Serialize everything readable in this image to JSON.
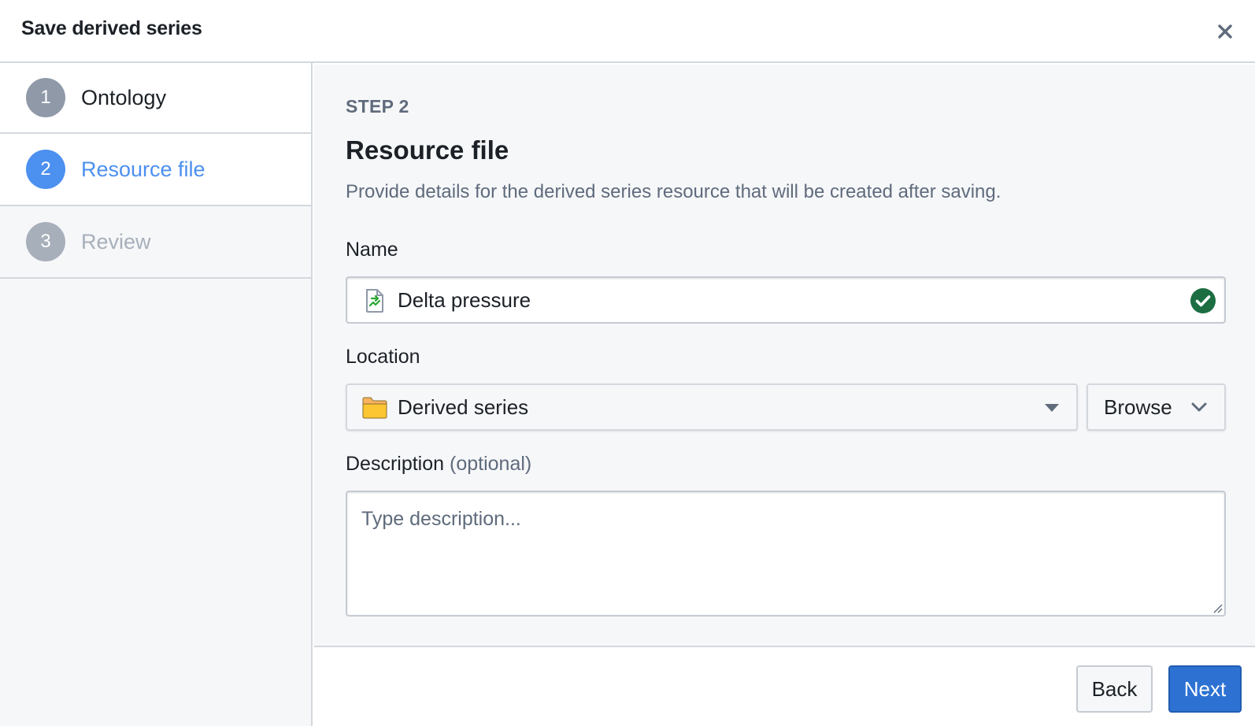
{
  "dialog": {
    "title": "Save derived series",
    "close_icon": "close-icon"
  },
  "steps": [
    {
      "number": "1",
      "label": "Ontology",
      "state": "completed"
    },
    {
      "number": "2",
      "label": "Resource file",
      "state": "active"
    },
    {
      "number": "3",
      "label": "Review",
      "state": "upcoming"
    }
  ],
  "main": {
    "kicker": "STEP 2",
    "title": "Resource file",
    "description": "Provide details for the derived series resource that will be created after saving.",
    "name": {
      "label": "Name",
      "value": "Delta pressure",
      "icon": "derived-series-file-icon",
      "status_icon": "valid-check-icon"
    },
    "location": {
      "label": "Location",
      "value": "Derived series",
      "icon": "folder-icon",
      "browse_label": "Browse"
    },
    "description_field": {
      "label": "Description",
      "optional_hint": "(optional)",
      "placeholder": "Type description...",
      "value": ""
    }
  },
  "footer": {
    "back_label": "Back",
    "next_label": "Next"
  },
  "colors": {
    "accent": "#2d72d2",
    "active_step": "#4c90f0",
    "success": "#1c6e42",
    "folder": "#fbb360"
  }
}
